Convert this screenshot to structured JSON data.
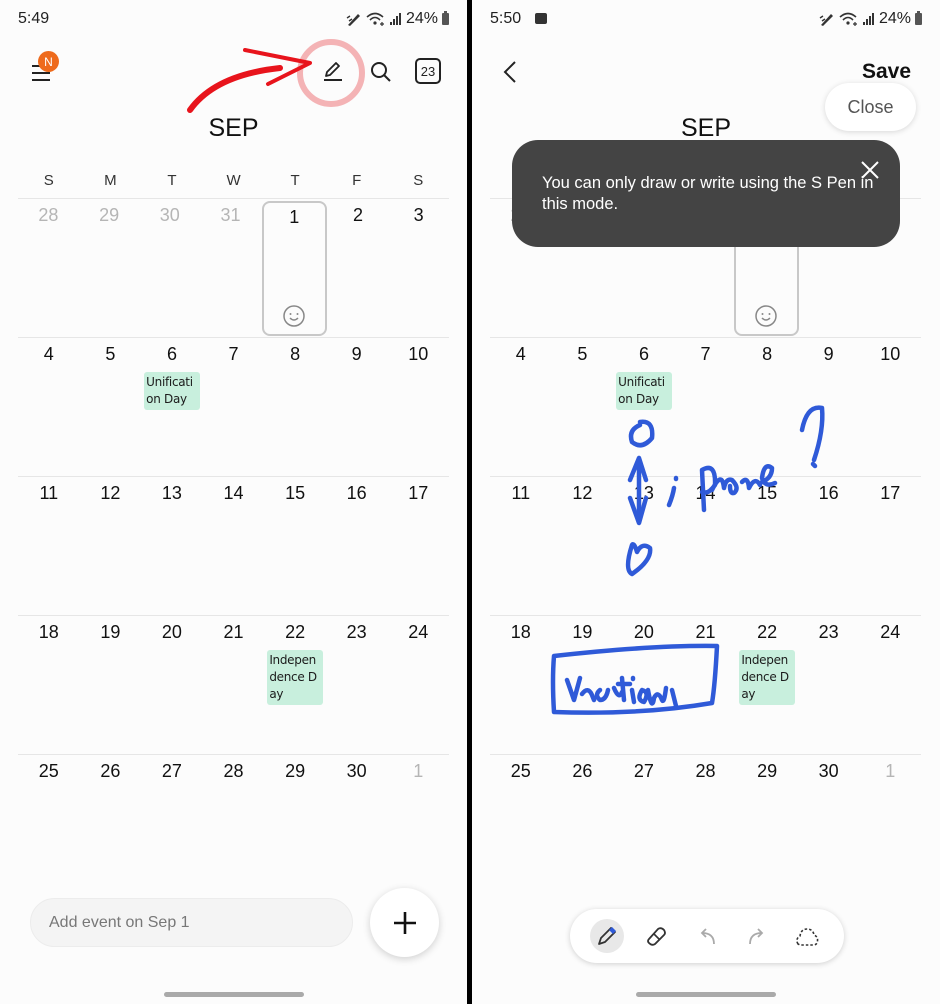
{
  "left": {
    "status": {
      "time": "5:49",
      "battery": "24%"
    },
    "toolbar": {
      "menu_badge": "N",
      "icons": [
        "menu-icon",
        "pen-icon",
        "search-icon",
        "today-icon"
      ],
      "today_label": "23"
    },
    "month": "SEP",
    "weekdays": [
      "S",
      "M",
      "T",
      "W",
      "T",
      "F",
      "S"
    ],
    "weeks": [
      [
        {
          "d": "28",
          "dim": true
        },
        {
          "d": "29",
          "dim": true
        },
        {
          "d": "30",
          "dim": true
        },
        {
          "d": "31",
          "dim": true
        },
        {
          "d": "1",
          "selected": true
        },
        {
          "d": "2"
        },
        {
          "d": "3"
        }
      ],
      [
        {
          "d": "4"
        },
        {
          "d": "5"
        },
        {
          "d": "6",
          "event": "Unification Day"
        },
        {
          "d": "7"
        },
        {
          "d": "8"
        },
        {
          "d": "9"
        },
        {
          "d": "10"
        }
      ],
      [
        {
          "d": "11"
        },
        {
          "d": "12"
        },
        {
          "d": "13"
        },
        {
          "d": "14"
        },
        {
          "d": "15"
        },
        {
          "d": "16"
        },
        {
          "d": "17"
        }
      ],
      [
        {
          "d": "18"
        },
        {
          "d": "19"
        },
        {
          "d": "20"
        },
        {
          "d": "21"
        },
        {
          "d": "22",
          "event": "Independence Day"
        },
        {
          "d": "23"
        },
        {
          "d": "24"
        }
      ],
      [
        {
          "d": "25"
        },
        {
          "d": "26"
        },
        {
          "d": "27"
        },
        {
          "d": "28"
        },
        {
          "d": "29"
        },
        {
          "d": "30"
        },
        {
          "d": "1",
          "dim": true
        }
      ]
    ],
    "add_event_placeholder": "Add event on Sep 1",
    "fab_icon": "plus-icon",
    "annotation_color": "#e8141c"
  },
  "right": {
    "status": {
      "time": "5:50",
      "battery": "24%"
    },
    "back_icon": "back-icon",
    "save_label": "Save",
    "close_label": "Close",
    "month": "SEP",
    "toast": {
      "text": "You can only draw or write using the S Pen in this mode."
    },
    "handwriting": [
      "iPhone?",
      "vacation"
    ],
    "ink_color": "#2f5ad8",
    "pen_tools": [
      "pen-icon",
      "eraser-icon",
      "undo-icon",
      "redo-icon",
      "lasso-icon"
    ]
  },
  "colors": {
    "event_bg": "#c8efdd",
    "toast_bg": "#444444",
    "badge": "#ee6a1c"
  }
}
